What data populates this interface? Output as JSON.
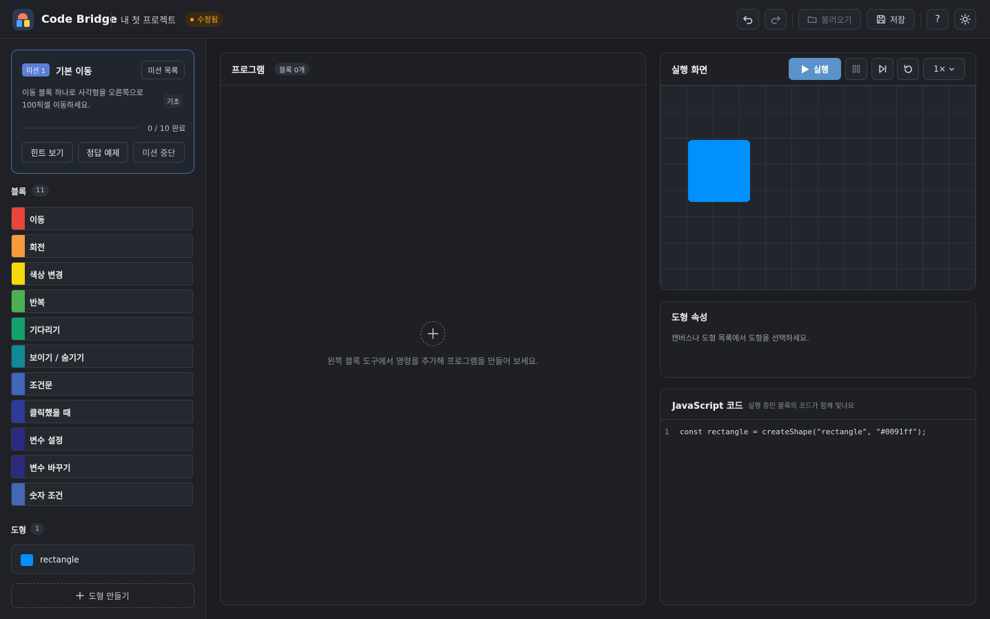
{
  "header": {
    "brand": "Code Bridge",
    "project_name": "내 첫 프로젝트",
    "status": "수정됨",
    "open_label": "불러오기",
    "save_label": "저장",
    "help_label": "?"
  },
  "mission": {
    "badge": "미션 1",
    "title": "기본 이동",
    "list_button": "미션 목록",
    "description": "이동 블록 하나로 사각형을 오른쪽으로 100픽셀 이동하세요.",
    "level": "기초",
    "progress_text": "0 / 10 완료",
    "progress_fraction": 0,
    "buttons": {
      "hint": "힌트 보기",
      "answer": "정답 예제",
      "stop": "미션 중단"
    }
  },
  "blocks": {
    "title": "블록",
    "count": "11",
    "items": [
      {
        "label": "이동",
        "color": "#e8453c"
      },
      {
        "label": "회전",
        "color": "#f79a3e"
      },
      {
        "label": "색상 변경",
        "color": "#f5d90a"
      },
      {
        "label": "반복",
        "color": "#4caf50"
      },
      {
        "label": "기다리기",
        "color": "#14a06b"
      },
      {
        "label": "보이기 / 숨기기",
        "color": "#0f8a96"
      },
      {
        "label": "조건문",
        "color": "#3f66b8"
      },
      {
        "label": "클릭했을 때",
        "color": "#2f3a9e"
      },
      {
        "label": "변수 설정",
        "color": "#2c2a7e"
      },
      {
        "label": "변수 바꾸기",
        "color": "#2c2a7e"
      },
      {
        "label": "숫자 조건",
        "color": "#4468b8"
      }
    ]
  },
  "shapes": {
    "title": "도형",
    "count": "1",
    "items": [
      {
        "name": "rectangle",
        "color": "#0091ff"
      }
    ],
    "add_label": "도형 만들기"
  },
  "program": {
    "title": "프로그램",
    "badge": "블록 0개",
    "empty_text": "왼쪽 블록 도구에서 명령을 추가해 프로그램을 만들어 보세요."
  },
  "run": {
    "title": "실행 화면",
    "run_label": "실행",
    "speed": "1×"
  },
  "props": {
    "title": "도형 속성",
    "hint": "캔버스나 도형 목록에서 도형을 선택하세요."
  },
  "code": {
    "title": "JavaScript 코드",
    "subtitle": "실행 중인 블록의 코드가 함께 빛나요",
    "lines": [
      {
        "num": "1",
        "text": "const rectangle = createShape(\"rectangle\", \"#0091ff\");"
      }
    ]
  }
}
